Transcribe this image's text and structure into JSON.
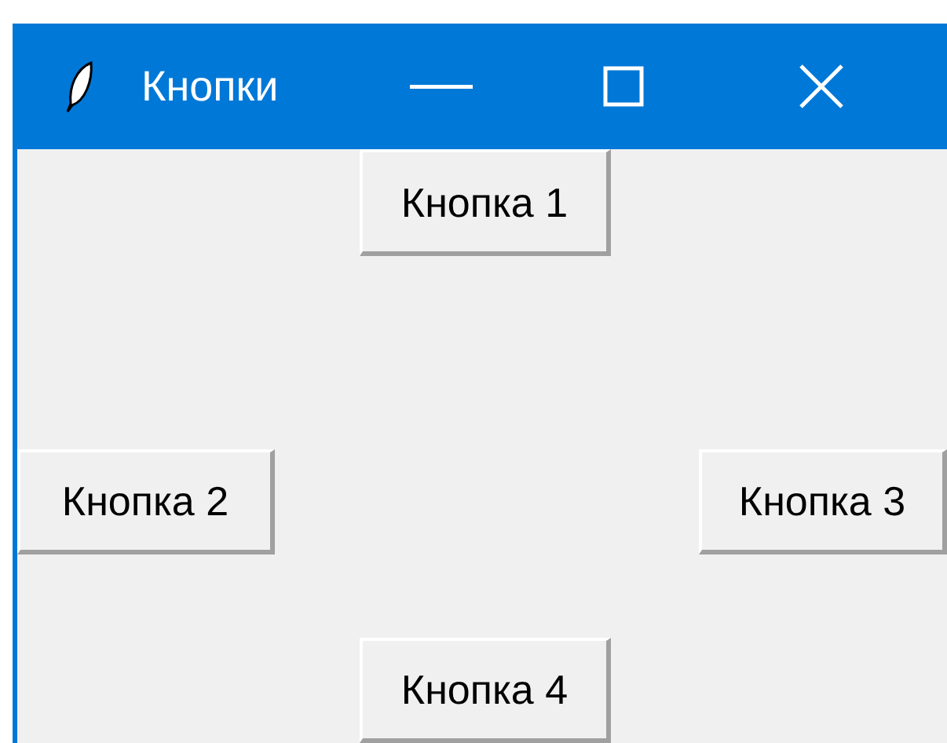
{
  "window": {
    "title": "Кнопки"
  },
  "buttons": [
    {
      "label": "Кнопка 1",
      "kind": "top"
    },
    {
      "label": "Кнопка 2",
      "kind": "left"
    },
    {
      "label": "Кнопка 3",
      "kind": "right"
    },
    {
      "label": "Кнопка 4",
      "kind": "bottom"
    }
  ]
}
